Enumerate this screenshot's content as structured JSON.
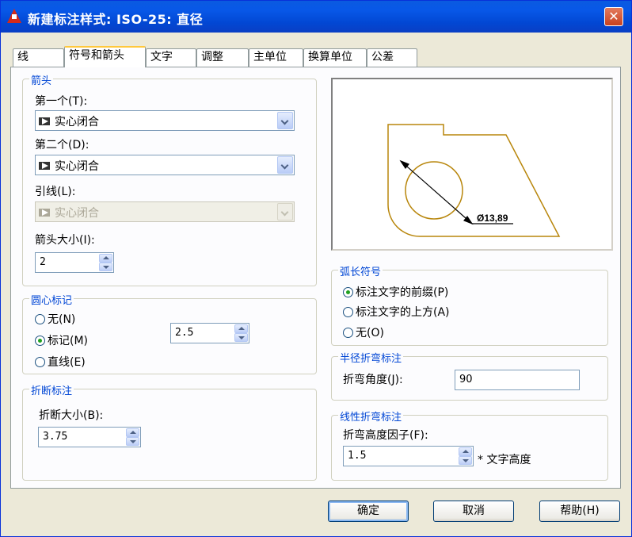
{
  "window": {
    "title": "新建标注样式: ISO-25: 直径"
  },
  "tabs": [
    {
      "label": "线"
    },
    {
      "label": "符号和箭头"
    },
    {
      "label": "文字"
    },
    {
      "label": "调整"
    },
    {
      "label": "主单位"
    },
    {
      "label": "换算单位"
    },
    {
      "label": "公差"
    }
  ],
  "arrowheads": {
    "title": "箭头",
    "first_label": "第一个(T):",
    "first_value": "实心闭合",
    "second_label": "第二个(D):",
    "second_value": "实心闭合",
    "leader_label": "引线(L):",
    "leader_value": "实心闭合",
    "size_label": "箭头大小(I):",
    "size_value": "2"
  },
  "center_marks": {
    "title": "圆心标记",
    "none_label": "无(N)",
    "mark_label": "标记(M)",
    "line_label": "直线(E)",
    "selected": "mark",
    "size_value": "2.5"
  },
  "dim_break": {
    "title": "折断标注",
    "size_label": "折断大小(B):",
    "size_value": "3.75"
  },
  "preview": {
    "dimension_text": "Ø13,89",
    "line_color": "#b8860b"
  },
  "arc_length": {
    "title": "弧长符号",
    "prefix_label": "标注文字的前缀(P)",
    "above_label": "标注文字的上方(A)",
    "none_label": "无(O)",
    "selected": "prefix"
  },
  "radius_jog": {
    "title": "半径折弯标注",
    "angle_label": "折弯角度(J):",
    "angle_value": "90"
  },
  "linear_jog": {
    "title": "线性折弯标注",
    "factor_label": "折弯高度因子(F):",
    "factor_value": "1.5",
    "suffix_label": "* 文字高度"
  },
  "buttons": {
    "ok": "确定",
    "cancel": "取消",
    "help": "帮助(H)"
  },
  "colors": {
    "accent": "#0046d5",
    "titlebar": "#0858e8"
  }
}
